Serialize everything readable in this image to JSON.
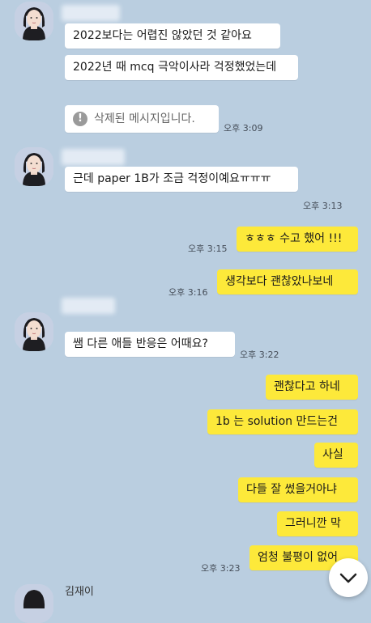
{
  "senders": {
    "top_name": "",
    "mid_name": "",
    "mid2_name": "",
    "bottom_name": "김재이"
  },
  "messages": {
    "m1": "2022보다는 어렵진 않았던 것 같아요",
    "m2": "2022년 때 mcq 극악이사라 걱정했었는데",
    "m3": "삭제된 메시지입니다.",
    "m4": "근데 paper 1B가 조금 걱정이예요ㅠㅠㅠ",
    "m5": "ㅎㅎㅎ 수고 했어 !!!",
    "m6": "생각보다 괜찮았나보네",
    "m7": "쌤 다른 애들 반응은 어때요?",
    "m8": "괜찮다고 하네",
    "m9": "1b 는 solution 만드는건",
    "m10": "사실",
    "m11": "다들 잘 썼을거아냐",
    "m12": "그러니깐 막",
    "m13": "엄청 불평이 없어"
  },
  "times": {
    "t1": "오후 3:09",
    "t2": "오후 3:13",
    "t3": "오후 3:15",
    "t4": "오후 3:16",
    "t5": "오후 3:22",
    "t6": "오후 3:23"
  },
  "colors": {
    "background": "#bacee0",
    "incoming": "#ffffff",
    "outgoing": "#fde93a"
  },
  "icons": {
    "deleted": "warning-circle-icon",
    "scroll": "chevron-down-icon"
  }
}
